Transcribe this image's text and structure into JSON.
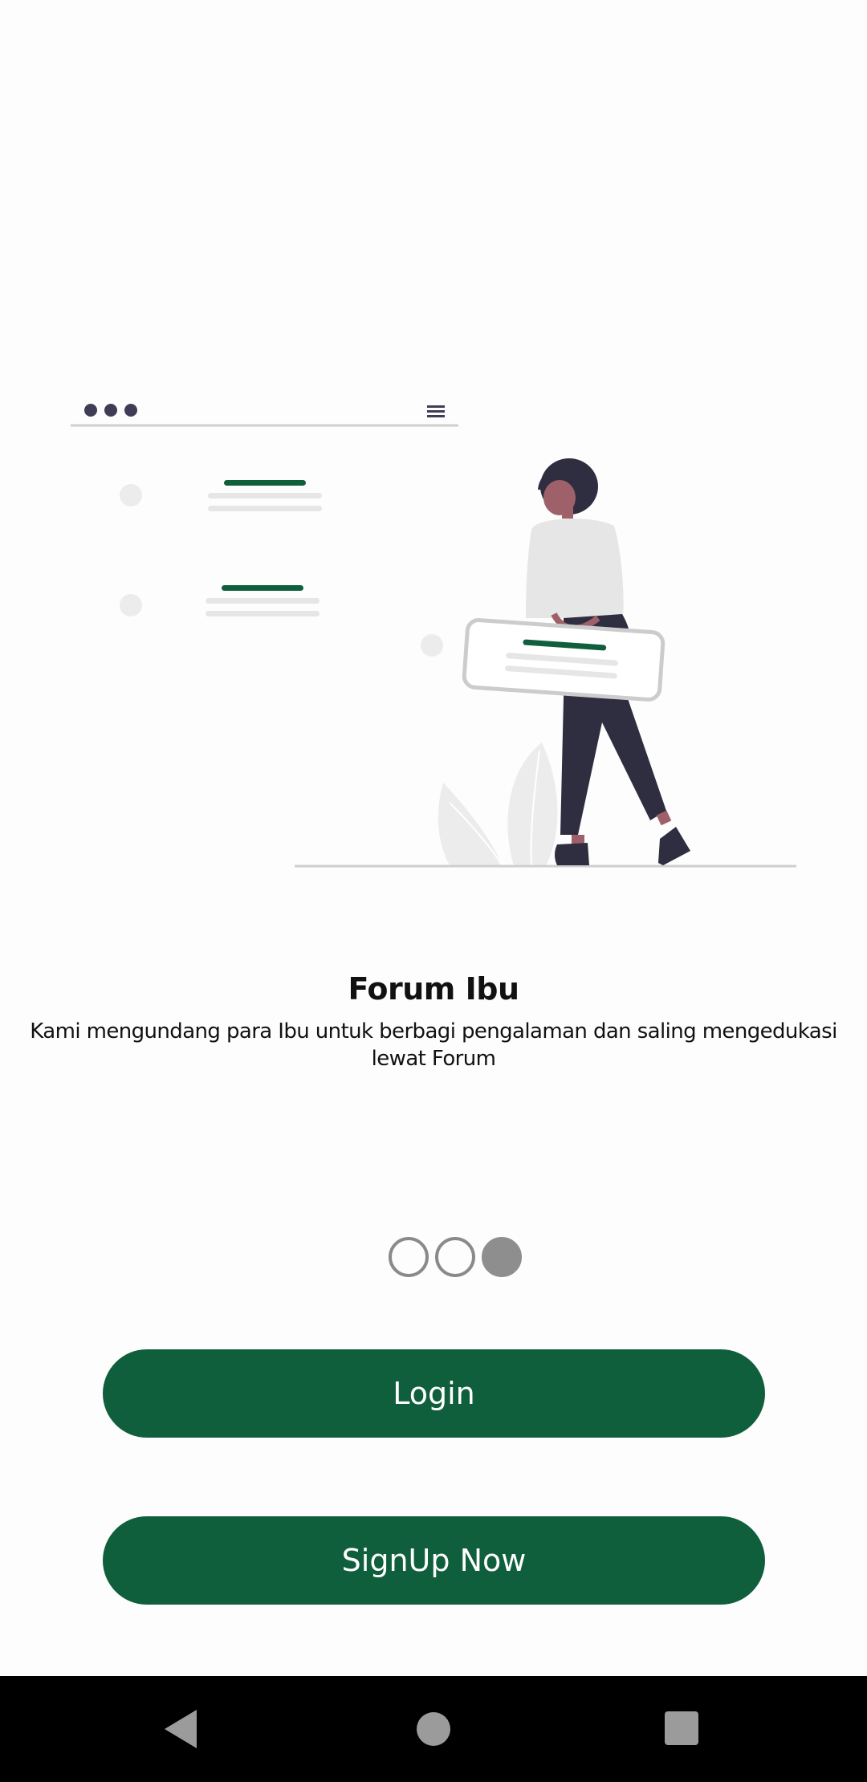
{
  "onboarding": {
    "title": "Forum Ibu",
    "description": "Kami mengundang para Ibu untuk berbagi pengalaman dan saling mengedukasi lewat Forum",
    "page_indicator": {
      "total": 3,
      "current": 3
    }
  },
  "buttons": {
    "login_label": "Login",
    "signup_label": "SignUp Now"
  },
  "illustration": {
    "icon": "woman-holding-message-card-illustration"
  },
  "navigation_bar": {
    "back_icon": "triangle-back-icon",
    "home_icon": "circle-home-icon",
    "recents_icon": "square-recents-icon"
  },
  "colors": {
    "primary": "#0f5e3c",
    "indicator": "#8e8e8e",
    "background": "#fdfdfd",
    "navbar": "#000000"
  }
}
